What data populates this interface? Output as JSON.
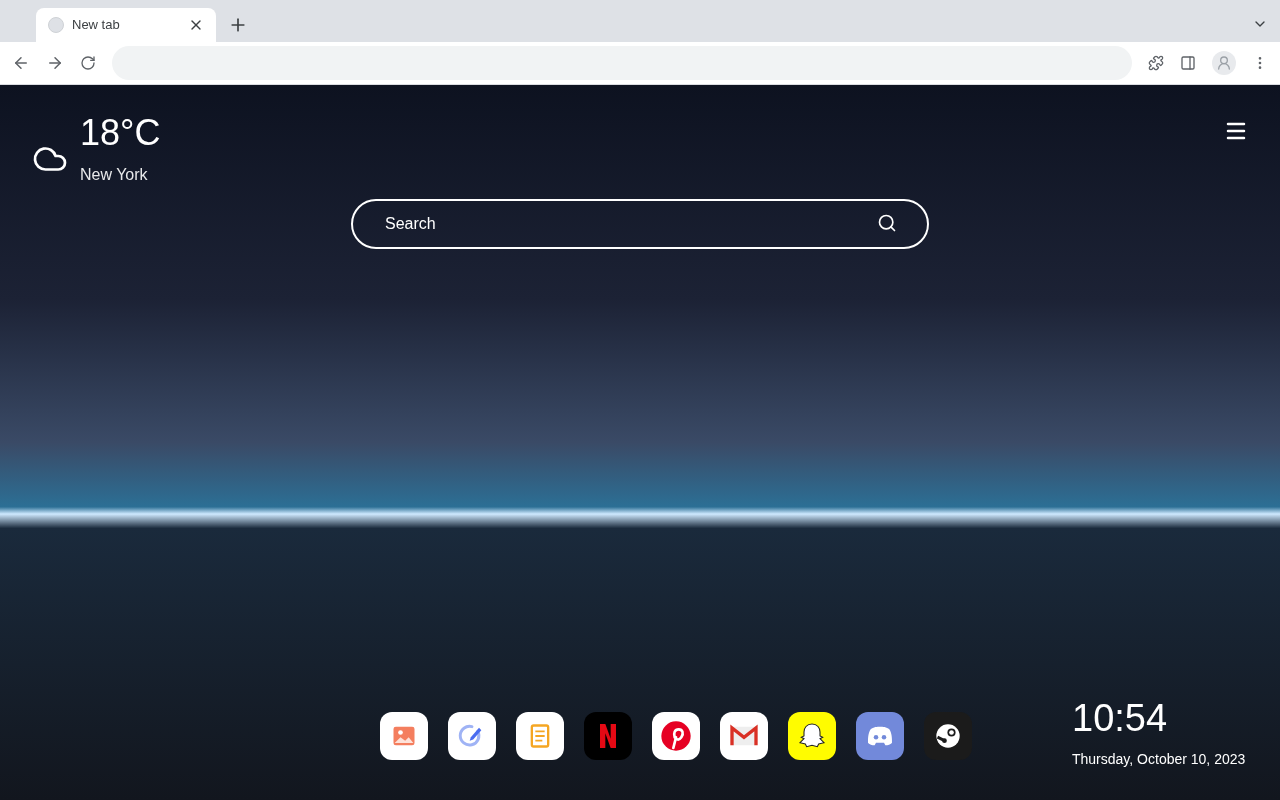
{
  "tab": {
    "title": "New tab",
    "selected": true
  },
  "weather": {
    "temperature": "18°C",
    "city": "New York"
  },
  "search": {
    "placeholder": "Search"
  },
  "dock": [
    {
      "kind": "gallery"
    },
    {
      "kind": "edit"
    },
    {
      "kind": "notes"
    },
    {
      "kind": "netflix"
    },
    {
      "kind": "pinterest"
    },
    {
      "kind": "gmail"
    },
    {
      "kind": "snapchat"
    },
    {
      "kind": "discord"
    },
    {
      "kind": "steam"
    }
  ],
  "clock": {
    "time": "10:54",
    "date": "Thursday, October 10, 2023"
  }
}
